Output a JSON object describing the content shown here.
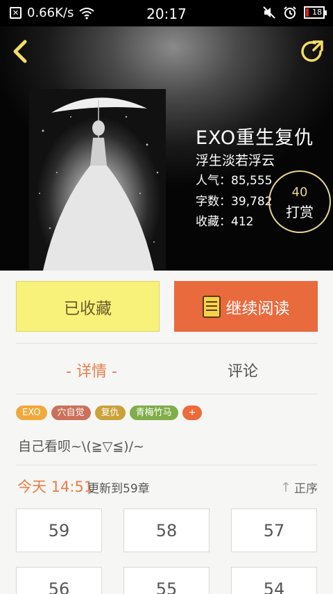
{
  "status_bar": {
    "net_speed": "0.66K/s",
    "time": "20:17",
    "battery": "18"
  },
  "book": {
    "title": "EXO重生复仇",
    "author": "浮生淡若浮云",
    "popularity": "人气：85,555",
    "word_count": "字数：39,782",
    "favorites": "收藏：412",
    "reward_count": "40",
    "reward_label": "打赏"
  },
  "actions": {
    "favorited": "已收藏",
    "continue_reading": "继续阅读"
  },
  "tabs": {
    "details": "- 详情 -",
    "comments": "评论"
  },
  "tags": [
    {
      "label": "EXO",
      "color": "#f0a93a"
    },
    {
      "label": "穴自觉",
      "color": "#c9715a"
    },
    {
      "label": "复仇",
      "color": "#c9a23a"
    },
    {
      "label": "青梅竹马",
      "color": "#7fae4a"
    },
    {
      "label": "+",
      "color": "#ef6a3a"
    }
  ],
  "intro": "自己看呗~\\(≧▽≦)/~",
  "update": {
    "today": "今天 14:51",
    "text": "更新到59章",
    "sort": "正序"
  },
  "chapters": [
    "59",
    "58",
    "57",
    "56",
    "55",
    "54"
  ]
}
